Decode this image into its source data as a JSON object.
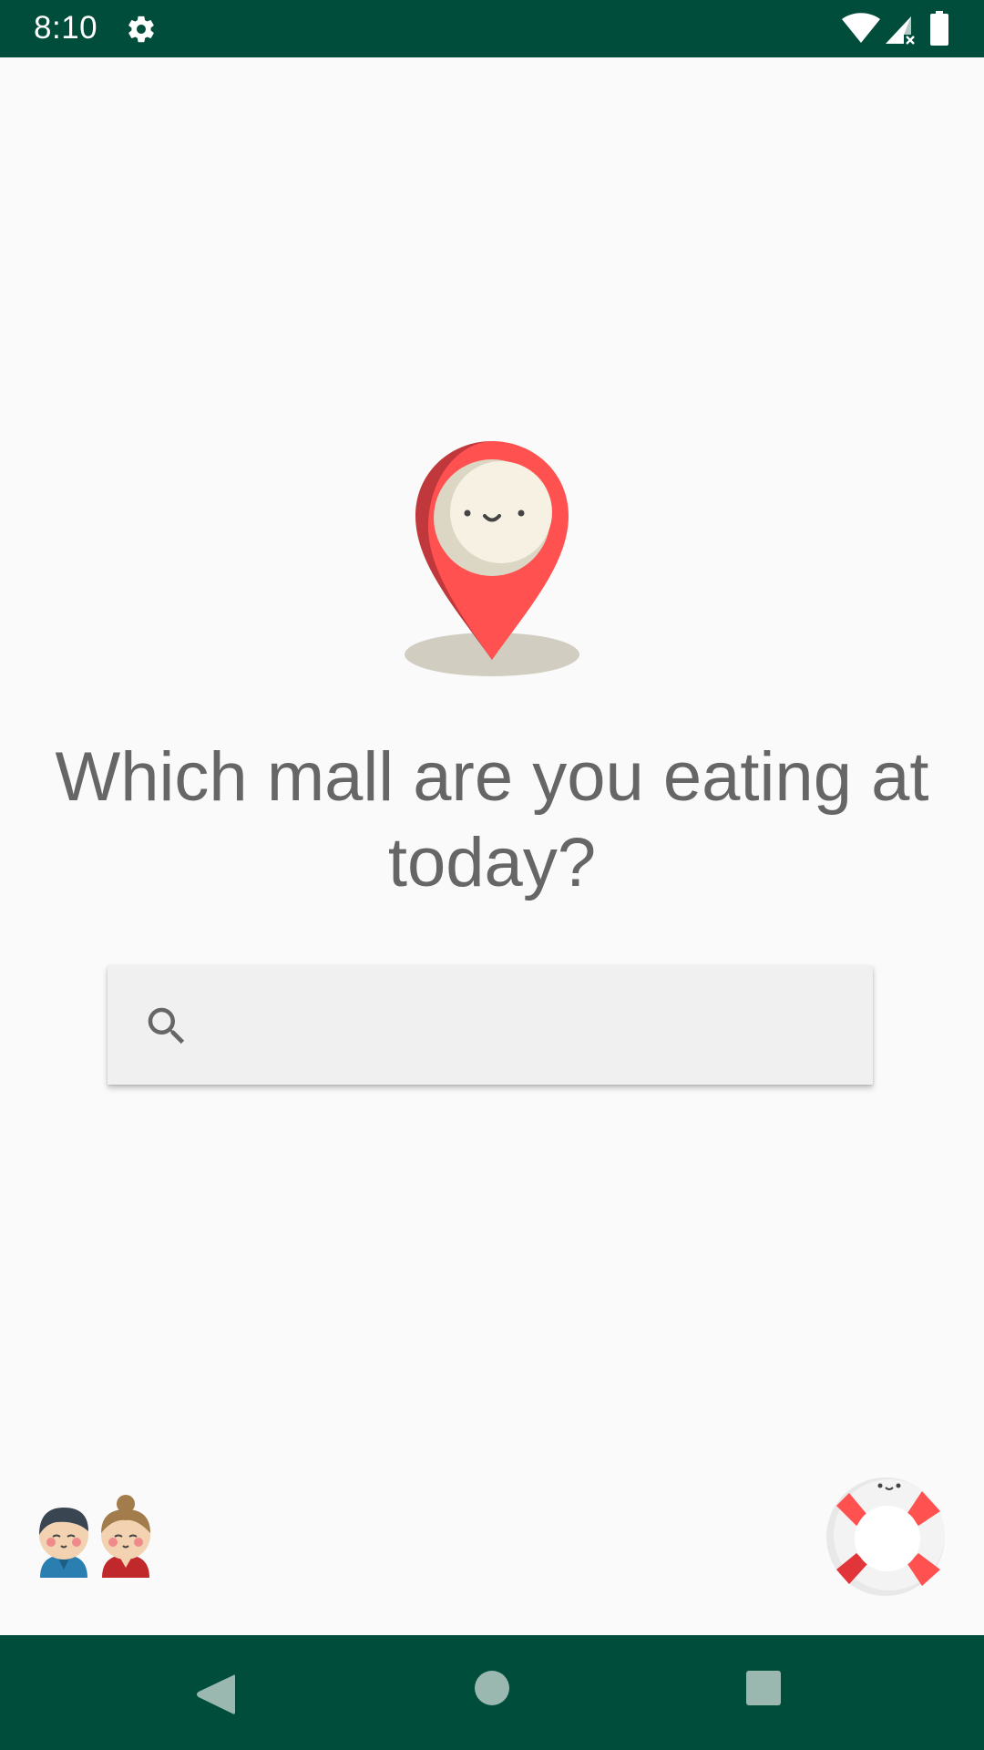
{
  "status_bar": {
    "time": "8:10",
    "icons": [
      "gear-icon",
      "wifi-icon",
      "signal-icon",
      "battery-icon"
    ]
  },
  "main": {
    "illustration": "map-pin-icon",
    "headline": "Which mall are you eating at today?",
    "search": {
      "icon": "search-icon",
      "value": "",
      "placeholder": ""
    }
  },
  "bottom": {
    "left_icon": "couple-icon",
    "right_icon": "lifebuoy-icon"
  },
  "nav_bar": {
    "buttons": [
      "back",
      "home",
      "recents"
    ]
  },
  "colors": {
    "bar": "#004d3b",
    "background": "#fafafa",
    "text": "#666666",
    "pin_red": "#fe5150",
    "search_bg": "#f0f0f0",
    "nav_icon": "#9ab8b0"
  }
}
